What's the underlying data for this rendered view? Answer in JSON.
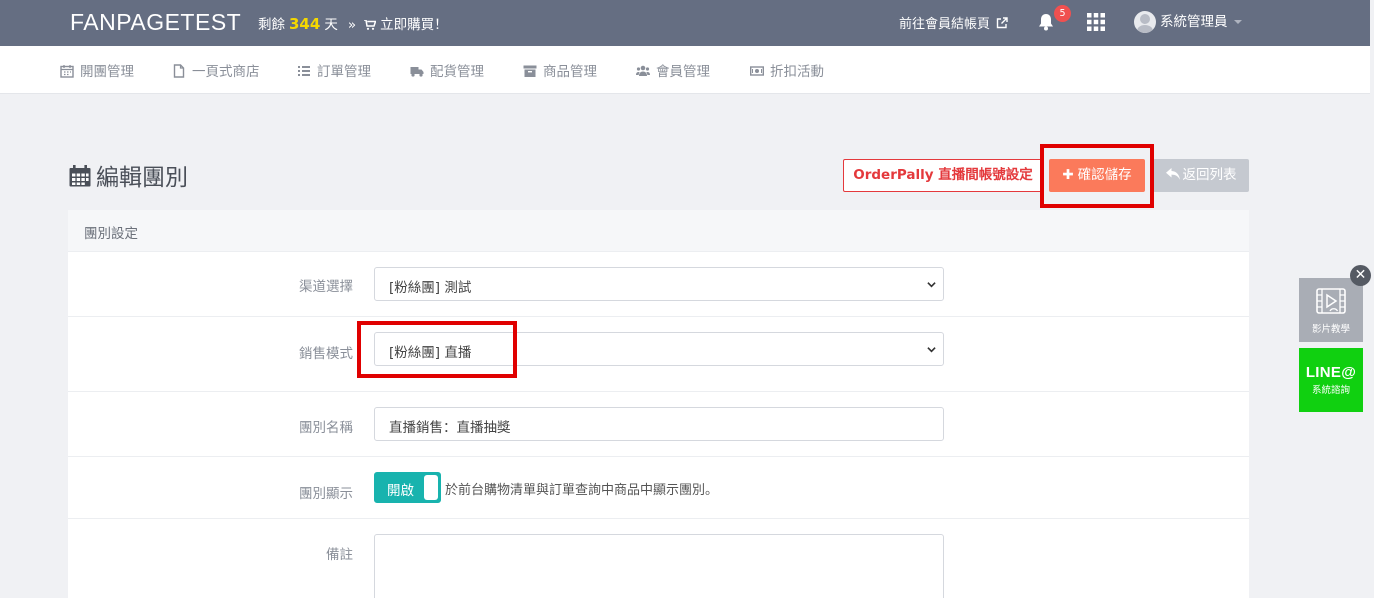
{
  "topbar": {
    "brand": "FANPAGETEST",
    "remain_prefix": "剩餘",
    "remain_days": "344",
    "remain_suffix": "天",
    "separator": "»",
    "buy_now": "立即購買！",
    "checkout_link": "前往會員結帳頁",
    "notification_count": "5",
    "user_name": "系統管理員"
  },
  "nav": {
    "items": [
      {
        "label": "開團管理",
        "icon": "calendar-icon"
      },
      {
        "label": "一頁式商店",
        "icon": "file-icon"
      },
      {
        "label": "訂單管理",
        "icon": "list-icon"
      },
      {
        "label": "配貨管理",
        "icon": "truck-icon"
      },
      {
        "label": "商品管理",
        "icon": "archive-icon"
      },
      {
        "label": "會員管理",
        "icon": "users-icon"
      },
      {
        "label": "折扣活動",
        "icon": "money-icon"
      }
    ]
  },
  "page": {
    "title": "編輯團別",
    "orderpally_button": "OrderPally 直播間帳號設定",
    "save_button": "確認儲存",
    "back_button": "返回列表"
  },
  "panel": {
    "header": "團別設定",
    "channel_label": "渠道選擇",
    "channel_value": "[粉絲團] 測試",
    "sales_mode_label": "銷售模式",
    "sales_mode_value": "[粉絲團] 直播",
    "group_name_label": "團別名稱",
    "group_name_value": "直播銷售：直播抽獎",
    "display_label": "團別顯示",
    "display_toggle": "開啟",
    "display_desc": "於前台購物清單與訂單查詢中商品中顯示團別。",
    "note_label": "備註"
  },
  "widgets": {
    "close": "✕",
    "video_label": "影片教學",
    "line_big": "LINE@",
    "line_small": "系統諮詢"
  },
  "colors": {
    "topbar": "#656e82",
    "accent_orange": "#fb7a5b",
    "accent_red": "#e4393c",
    "toggle_teal": "#18b3ae",
    "line_green": "#10d010",
    "highlight": "#e00000"
  }
}
